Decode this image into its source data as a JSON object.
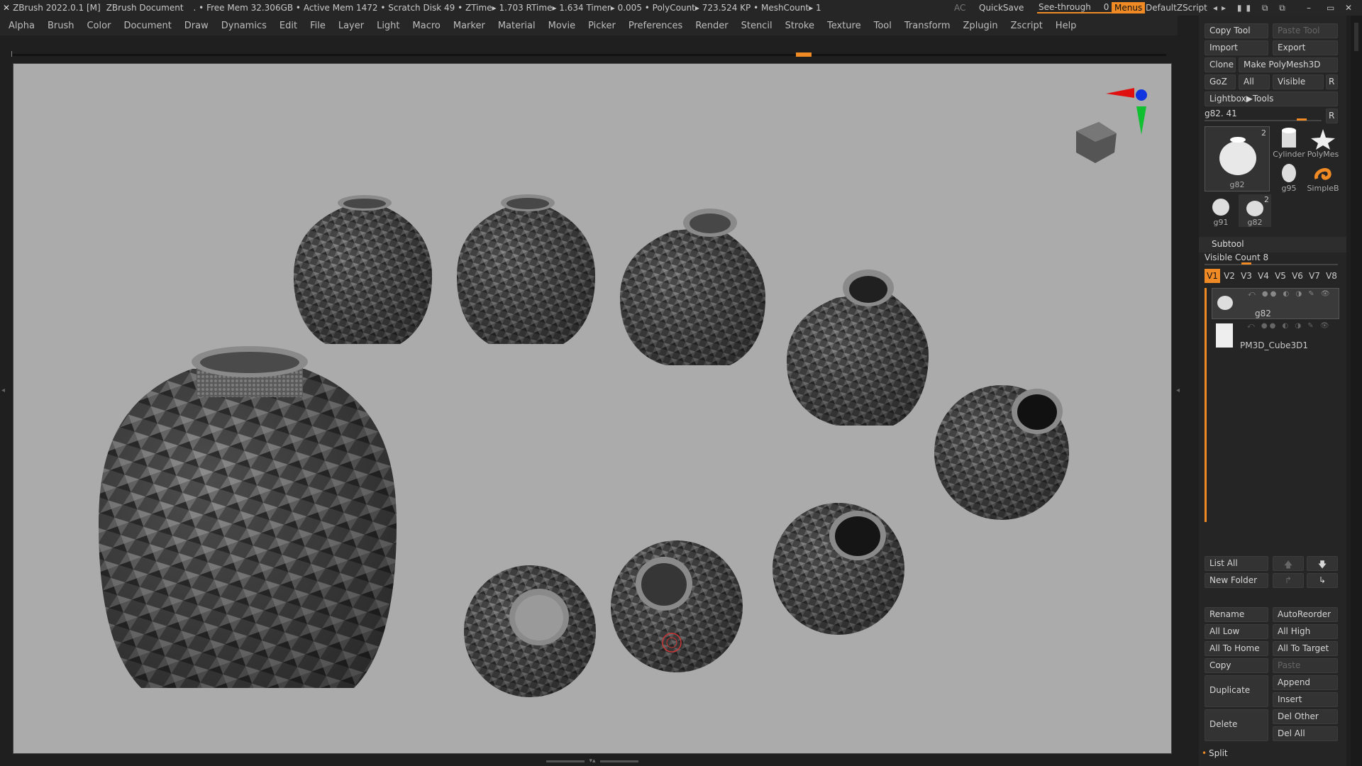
{
  "titlebar": {
    "app": "ZBrush 2022.0.1 [M]",
    "doc": "ZBrush Document",
    "stats": ". • Free Mem 32.306GB • Active Mem 1472 • Scratch Disk 49 • ZTime▸ 1.703 RTime▸ 1.634 Timer▸ 0.005 • PolyCount▸ 723.524 KP • MeshCount▸ 1",
    "ac": "AC",
    "quicksave": "QuickSave",
    "seethrough": "See-through",
    "seethrough_val": "0",
    "menus": "Menus",
    "zscript": "DefaultZScript"
  },
  "menubar": [
    "Alpha",
    "Brush",
    "Color",
    "Document",
    "Draw",
    "Dynamics",
    "Edit",
    "File",
    "Layer",
    "Light",
    "Macro",
    "Marker",
    "Material",
    "Movie",
    "Picker",
    "Preferences",
    "Render",
    "Stencil",
    "Stroke",
    "Texture",
    "Tool",
    "Transform",
    "Zplugin",
    "Zscript",
    "Help"
  ],
  "tool_panel": {
    "copy_tool": "Copy Tool",
    "paste_tool": "Paste Tool",
    "import": "Import",
    "export": "Export",
    "clone": "Clone",
    "make_polymesh": "Make PolyMesh3D",
    "goz": "GoZ",
    "all": "All",
    "visible": "Visible",
    "r": "R",
    "lightbox_tools": "Lightbox▶Tools",
    "current_tool": "g82. 41",
    "r2": "R",
    "thumbs": [
      {
        "label": "g82",
        "count": "2"
      },
      {
        "label": "Cylinder"
      },
      {
        "label": "PolyMes"
      },
      {
        "label": "g95"
      },
      {
        "label": "SimpleB"
      },
      {
        "label": "g91"
      },
      {
        "label": "g82",
        "count": "2"
      }
    ]
  },
  "subtool": {
    "title": "Subtool",
    "visible_count": "Visible Count 8",
    "tabs": [
      "V1",
      "V2",
      "V3",
      "V4",
      "V5",
      "V6",
      "V7",
      "V8"
    ],
    "items": [
      "g82",
      "PM3D_Cube3D1"
    ],
    "list_all": "List All",
    "new_folder": "New Folder",
    "rename": "Rename",
    "autoreorder": "AutoReorder",
    "all_low": "All Low",
    "all_high": "All High",
    "all_to_home": "All To Home",
    "all_to_target": "All To Target",
    "copy": "Copy",
    "paste": "Paste",
    "duplicate": "Duplicate",
    "append": "Append",
    "insert": "Insert",
    "delete": "Delete",
    "del_other": "Del Other",
    "del_all": "Del All",
    "split": "Split"
  },
  "colors": {
    "accent": "#ef8a25",
    "canvas": "#ababab",
    "panel": "#252525"
  }
}
